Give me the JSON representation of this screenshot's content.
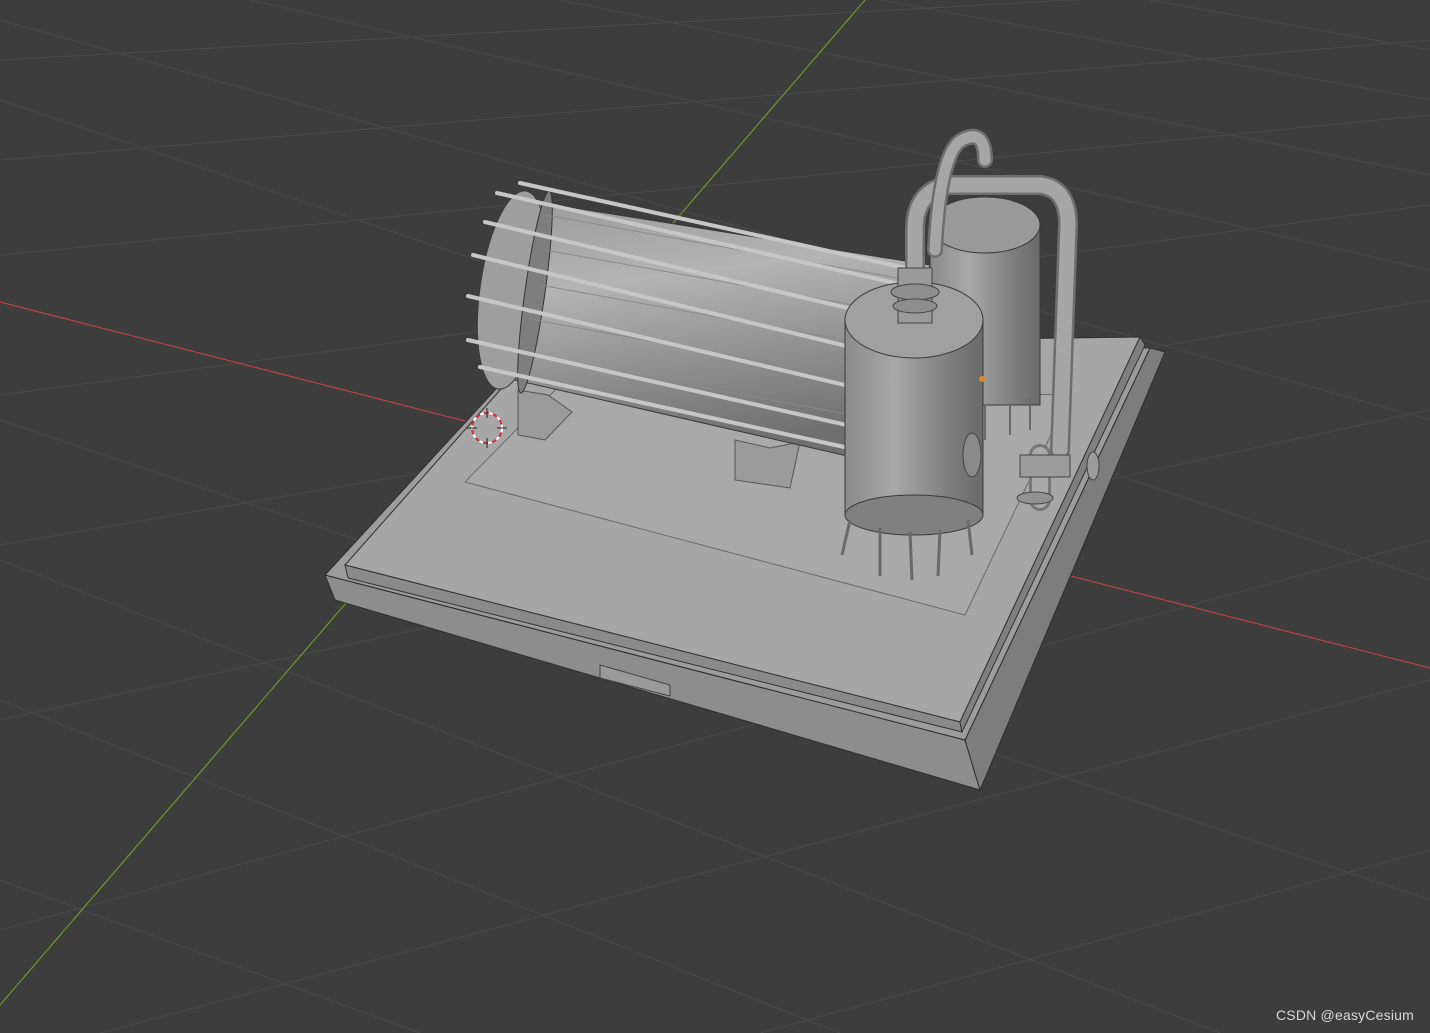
{
  "viewport": {
    "background_color": "#3d3d3d",
    "grid_color": "#484848",
    "x_axis_color": "#c0404a",
    "y_axis_color": "#6a9a2a"
  },
  "model": {
    "name": "",
    "base_color": "#a3a3a3"
  },
  "cursor_3d": {
    "icon": "3d-cursor-icon"
  },
  "origin_marker": {
    "icon": "origin-dot-icon",
    "color": "#e08a1e"
  },
  "watermark": {
    "text": "CSDN @easyCesium"
  }
}
